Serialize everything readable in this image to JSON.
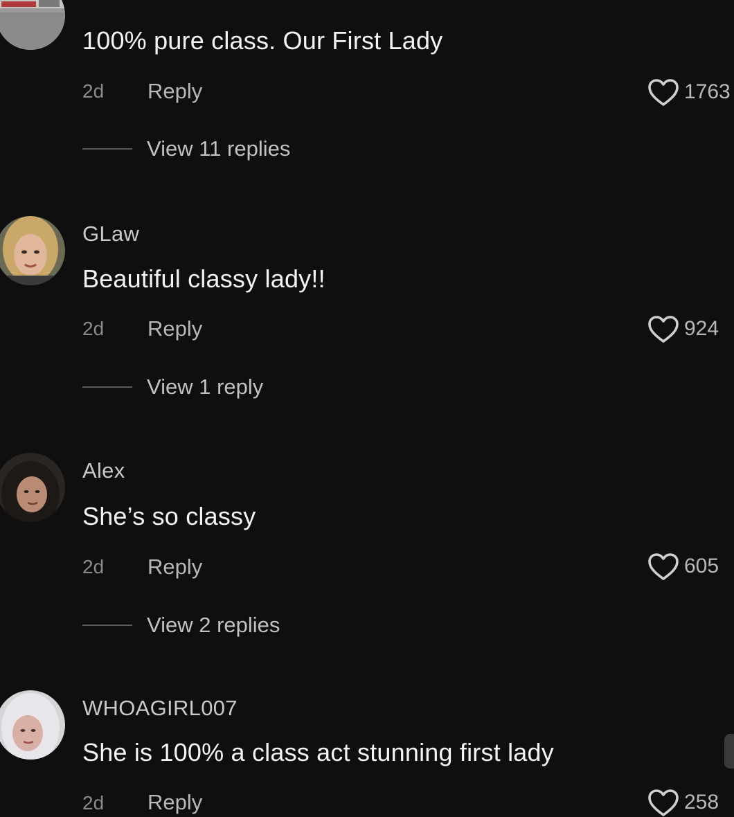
{
  "comments": [
    {
      "username": "",
      "text": "100% pure class. Our First Lady",
      "time": "2d",
      "reply_label": "Reply",
      "likes": "1763",
      "view_replies": "View 11 replies"
    },
    {
      "username": "GLaw",
      "text": "Beautiful classy lady!!",
      "time": "2d",
      "reply_label": "Reply",
      "likes": "924",
      "view_replies": "View 1 reply"
    },
    {
      "username": "Alex",
      "text": "She’s so classy",
      "time": "2d",
      "reply_label": "Reply",
      "likes": "605",
      "view_replies": "View 2 replies"
    },
    {
      "username": "WHOAGIRL007",
      "text": "She is 100% a class act stunning first lady",
      "time": "2d",
      "reply_label": "Reply",
      "likes": "258"
    }
  ],
  "icons": {
    "like": "heart-outline-icon"
  },
  "colors": {
    "background": "#0f0f10",
    "text_primary": "#f4f4f4",
    "text_secondary": "#b8b8bc",
    "text_muted": "#8a8a8e"
  }
}
